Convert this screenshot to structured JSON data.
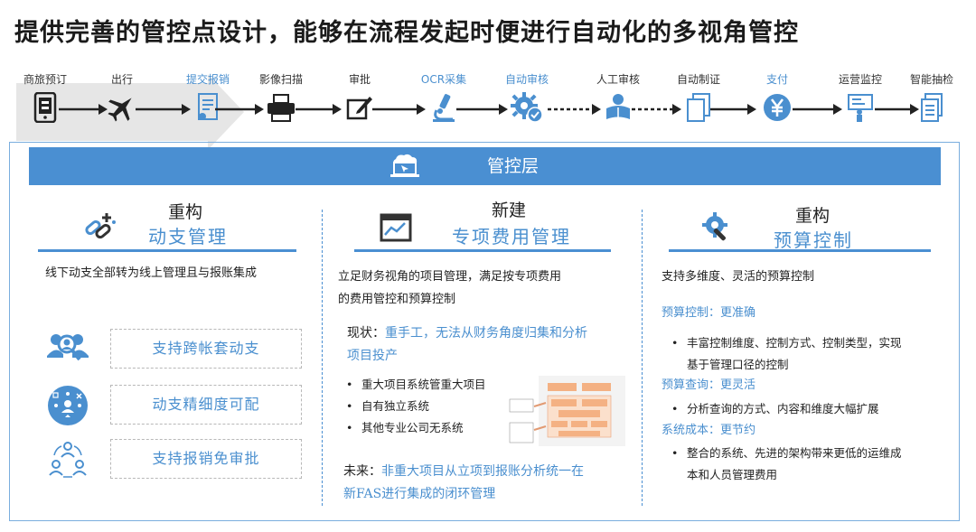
{
  "title": "提供完善的管控点设计，能够在流程发起时便进行自动化的多视角管控",
  "flow": {
    "steps": [
      {
        "label": "商旅预订",
        "icon": "tablet-icon"
      },
      {
        "label": "出行",
        "icon": "airplane-icon"
      },
      {
        "label": "提交报销",
        "icon": "submit-document-icon"
      },
      {
        "label": "影像扫描",
        "icon": "scanner-icon"
      },
      {
        "label": "审批",
        "icon": "approve-edit-icon"
      },
      {
        "label": "OCR采集",
        "icon": "microscope-icon"
      },
      {
        "label": "自动审核",
        "icon": "gear-check-icon"
      },
      {
        "label": "人工审核",
        "icon": "reviewer-icon"
      },
      {
        "label": "自动制证",
        "icon": "documents-icon"
      },
      {
        "label": "支付",
        "icon": "yen-icon"
      },
      {
        "label": "运营监控",
        "icon": "monitor-presenter-icon"
      },
      {
        "label": "智能抽检",
        "icon": "checklist-icon"
      }
    ]
  },
  "header": {
    "label": "管控层",
    "icon": "laptop-cloud-icon"
  },
  "col1": {
    "title1": "重构",
    "title2": "动支管理",
    "desc": "线下动支全部转为线上管理且与报账集成",
    "items": [
      {
        "label": "支持跨帐套动支",
        "icon": "users-search-icon"
      },
      {
        "label": "动支精细度可配",
        "icon": "user-network-icon"
      },
      {
        "label": "支持报销免审批",
        "icon": "users-cycle-icon"
      }
    ]
  },
  "col2": {
    "title1": "新建",
    "title2": "专项费用管理",
    "desc_line1": "立足财务视角的项目管理，满足按专项费用",
    "desc_line2": "的费用管控和预算控制",
    "status_label": "现状：",
    "status_text1": "重手工，无法从财务角度归集和分析",
    "status_text2": "项目投产",
    "bullets": [
      "重大项目系统管重大项目",
      "自有独立系统",
      "其他专业公司无系统"
    ],
    "future_label": "未来：",
    "future_text1": "非重大项目从立项到报账分析统一在",
    "future_text2": "新FAS进行集成的闭环管理"
  },
  "col3": {
    "title1": "重构",
    "title2": "预算控制",
    "desc": "支持多维度、灵活的预算控制",
    "sections": [
      {
        "heading": "预算控制：更准确",
        "lines": [
          "丰富控制维度、控制方式、控制类型，实现",
          "基于管理口径的控制"
        ]
      },
      {
        "heading": "预算查询：更灵活",
        "lines": [
          "分析查询的方式、内容和维度大幅扩展"
        ]
      },
      {
        "heading": "系统成本：更节约",
        "lines": [
          "整合的系统、先进的架构带来更低的运维成",
          "本和人员管理费用"
        ]
      }
    ]
  },
  "colors": {
    "accent": "#4a8fd2",
    "accent_text": "#4a8fcf",
    "band": "#e6e6e6"
  }
}
